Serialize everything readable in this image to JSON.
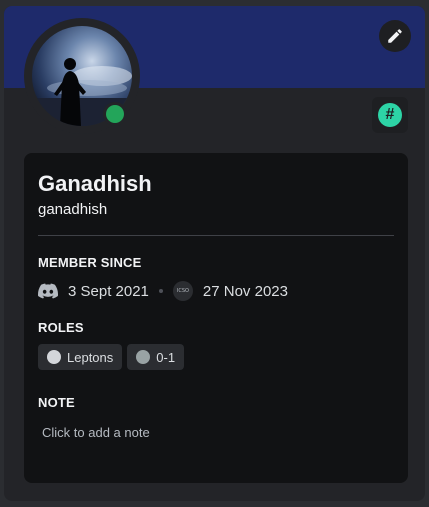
{
  "profile": {
    "display_name": "Ganadhish",
    "username": "ganadhish",
    "status": "online",
    "colors": {
      "banner": "#1e2a6b",
      "status_online": "#23a55a",
      "hash_badge": "#2dd4a6"
    }
  },
  "member_since": {
    "title": "MEMBER SINCE",
    "discord_date": "3 Sept 2021",
    "server_icon_text": "ICSO",
    "server_date": "27 Nov 2023"
  },
  "roles": {
    "title": "ROLES",
    "items": [
      {
        "label": "Leptons",
        "color": "#d3d6da"
      },
      {
        "label": "0-1",
        "color": "#99a3a4"
      }
    ]
  },
  "note": {
    "title": "NOTE",
    "placeholder": "Click to add a note"
  },
  "icons": {
    "edit": "pencil-icon",
    "badge": "hash-icon",
    "discord": "discord-logo-icon"
  }
}
